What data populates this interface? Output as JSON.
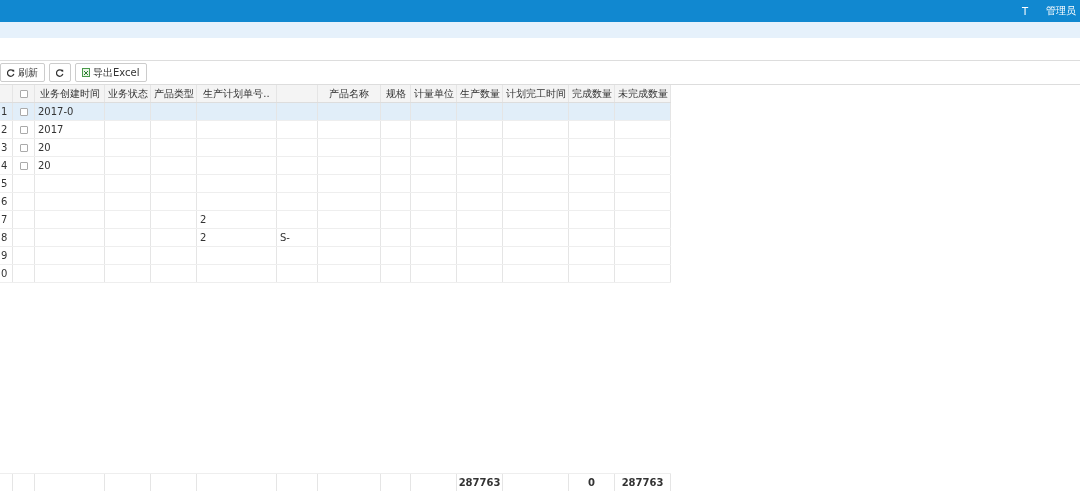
{
  "topbar": {
    "items": [
      "T",
      "管理员"
    ]
  },
  "toolbar": {
    "buttons": [
      {
        "kind": "refresh",
        "label": "刷新"
      },
      {
        "kind": "reload"
      },
      {
        "kind": "excel",
        "label": "导出Excel"
      }
    ]
  },
  "table": {
    "all_checked": false,
    "columns": [
      {
        "label": "业务创建时间"
      },
      {
        "label": "业务状态"
      },
      {
        "label": "产品类型"
      },
      {
        "label": "生产计划单号.."
      },
      {},
      {
        "label": "产品名称"
      },
      {
        "label": "规格"
      },
      {
        "label": "计量单位"
      },
      {
        "label": "生产数量",
        "total": "287763"
      },
      {
        "label": "计划完工时间"
      },
      {
        "label": "完成数量",
        "total": "0"
      },
      {
        "label": "未完成数量",
        "total": "287763"
      }
    ],
    "rows": [
      {
        "num": "1",
        "selected": true,
        "checked": false,
        "cells": {
          "0": "2017-0"
        }
      },
      {
        "num": "2",
        "selected": false,
        "checked": false,
        "cells": {
          "0": "2017"
        }
      },
      {
        "num": "3",
        "selected": false,
        "checked": false,
        "cells": {
          "0": "20"
        }
      },
      {
        "num": "4",
        "selected": false,
        "checked": false,
        "cells": {
          "0": "20"
        }
      },
      {
        "num": "5",
        "selected": false
      },
      {
        "num": "6",
        "selected": false
      },
      {
        "num": "7",
        "selected": false,
        "cells": {
          "3": "2"
        }
      },
      {
        "num": "8",
        "selected": false,
        "cells": {
          "3": "2",
          "4": "S-"
        }
      },
      {
        "num": "9",
        "selected": false
      },
      {
        "num": "0",
        "selected": false
      }
    ]
  }
}
